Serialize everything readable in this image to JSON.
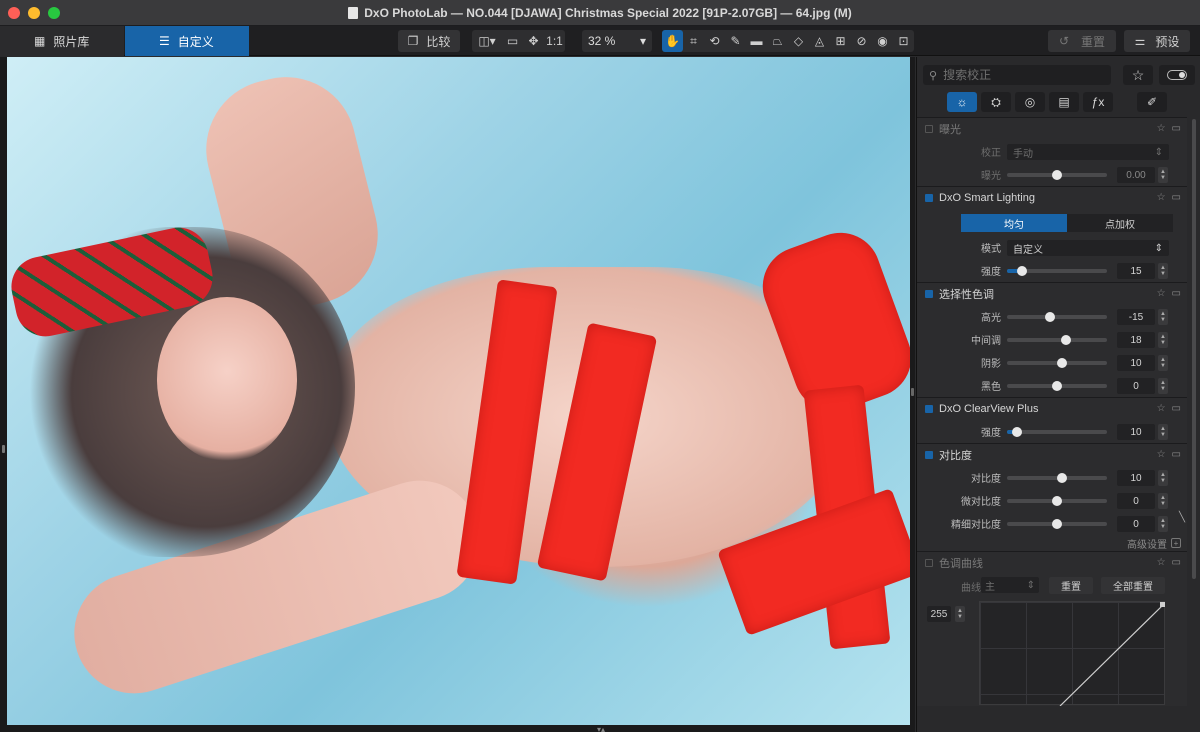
{
  "window": {
    "title": "DxO PhotoLab — NO.044 [DJAWA] Christmas Special 2022 [91P-2.07GB] — 64.jpg (M)"
  },
  "tabs": {
    "library": "照片库",
    "customize": "自定义"
  },
  "toolbar": {
    "compare": "比较",
    "ratio": "1:1",
    "zoom": "32 %",
    "reset": "重置",
    "presets": "预设"
  },
  "panel": {
    "search_placeholder": "搜索校正",
    "exposure": {
      "title": "曝光",
      "correction_label": "校正",
      "correction_value": "手动",
      "exposure_label": "曝光",
      "exposure_value": "0.00",
      "exposure_pos": 0.5
    },
    "smart_lighting": {
      "title": "DxO Smart Lighting",
      "mode_uniform": "均匀",
      "mode_spot": "点加权",
      "mode_label": "模式",
      "mode_value": "自定义",
      "intensity_label": "强度",
      "intensity_value": "15",
      "intensity_pos": 0.15
    },
    "selective_tone": {
      "title": "选择性色调",
      "highlights_label": "高光",
      "highlights_value": "-15",
      "highlights_pos": 0.425,
      "midtones_label": "中间调",
      "midtones_value": "18",
      "midtones_pos": 0.59,
      "shadows_label": "阴影",
      "shadows_value": "10",
      "shadows_pos": 0.55,
      "blacks_label": "黑色",
      "blacks_value": "0",
      "blacks_pos": 0.5
    },
    "clearview": {
      "title": "DxO ClearView Plus",
      "intensity_label": "强度",
      "intensity_value": "10",
      "intensity_pos": 0.1
    },
    "contrast": {
      "title": "对比度",
      "contrast_label": "对比度",
      "contrast_value": "10",
      "contrast_pos": 0.55,
      "micro_label": "微对比度",
      "micro_value": "0",
      "micro_pos": 0.5,
      "fine_label": "精细对比度",
      "fine_value": "0",
      "fine_pos": 0.5,
      "advanced": "高级设置"
    },
    "tone_curve": {
      "title": "色调曲线",
      "curve_label": "曲线",
      "curve_value": "主",
      "reset": "重置",
      "reset_all": "全部重置",
      "output_value": "255"
    }
  }
}
